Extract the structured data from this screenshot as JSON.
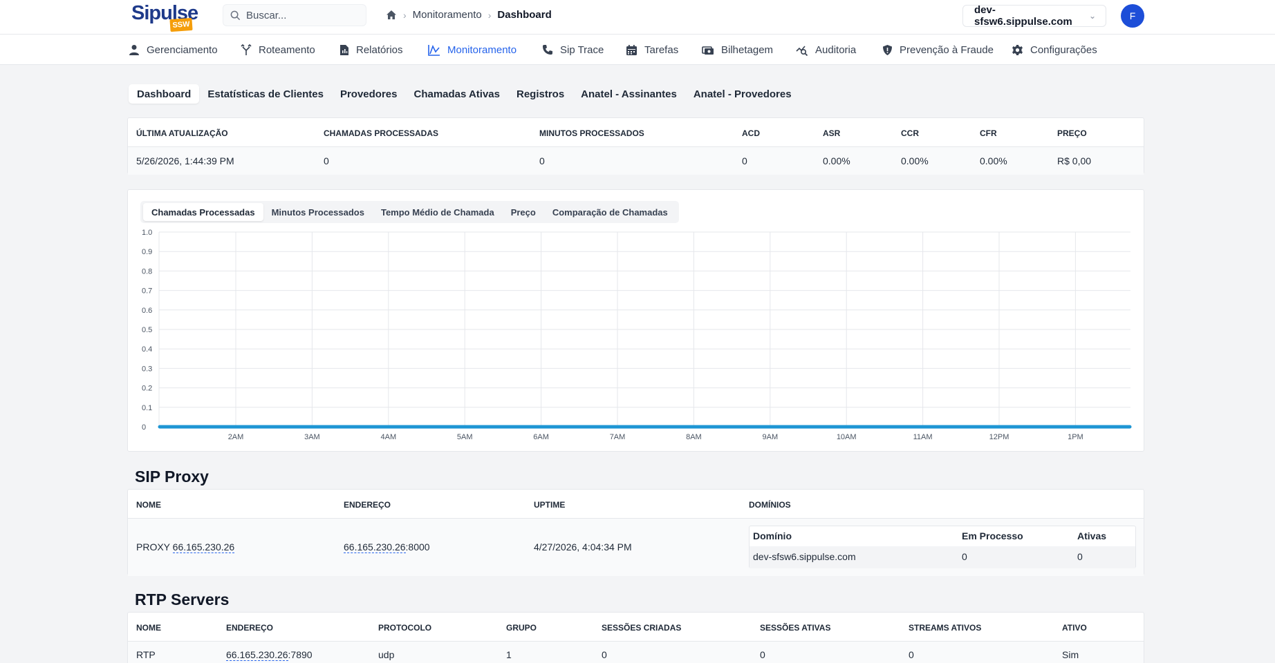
{
  "brand": {
    "logo_text": "Sipulse",
    "logo_badge": "SSW",
    "accent": "#2563eb",
    "orange": "#f59e0b"
  },
  "search": {
    "placeholder": "Buscar..."
  },
  "breadcrumb": {
    "parent": "Monitoramento",
    "current": "Dashboard"
  },
  "server": {
    "selected": "dev-sfsw6.sippulse.com"
  },
  "user": {
    "initial": "F"
  },
  "nav": [
    {
      "label": "Gerenciamento",
      "icon": "user-icon"
    },
    {
      "label": "Roteamento",
      "icon": "route-icon"
    },
    {
      "label": "Relatórios",
      "icon": "report-icon"
    },
    {
      "label": "Monitoramento",
      "icon": "chart-icon",
      "active": true
    },
    {
      "label": "Sip Trace",
      "icon": "phone-icon"
    },
    {
      "label": "Tarefas",
      "icon": "calendar-icon"
    },
    {
      "label": "Bilhetagem",
      "icon": "ticket-icon"
    },
    {
      "label": "Auditoria",
      "icon": "audit-icon"
    },
    {
      "label": "Prevenção à Fraude",
      "icon": "shield-icon"
    },
    {
      "label": "Configurações",
      "icon": "gear-icon"
    }
  ],
  "subtabs": [
    "Dashboard",
    "Estatísticas de Clientes",
    "Provedores",
    "Chamadas Ativas",
    "Registros",
    "Anatel - Assinantes",
    "Anatel - Provedores"
  ],
  "stats": {
    "headers": [
      "Última Atualização",
      "Chamadas Processadas",
      "Minutos Processados",
      "ACD",
      "ASR",
      "CCR",
      "CFR",
      "Preço"
    ],
    "values": [
      "5/26/2026, 1:44:39 PM",
      "0",
      "0",
      "0",
      "0.00%",
      "0.00%",
      "0.00%",
      "R$ 0,00"
    ]
  },
  "chart_tabs": [
    "Chamadas Processadas",
    "Minutos Processados",
    "Tempo Médio de Chamada",
    "Preço",
    "Comparação de Chamadas"
  ],
  "chart_data": {
    "type": "line",
    "title": "",
    "xlabel": "",
    "ylabel": "",
    "ylim": [
      0,
      1
    ],
    "yticks": [
      "1.0",
      "0.9",
      "0.8",
      "0.7",
      "0.6",
      "0.5",
      "0.4",
      "0.3",
      "0.2",
      "0.1",
      "0"
    ],
    "x": [
      "2AM",
      "3AM",
      "4AM",
      "5AM",
      "6AM",
      "7AM",
      "8AM",
      "9AM",
      "10AM",
      "11AM",
      "12PM",
      "1PM"
    ],
    "series": [
      {
        "values": [
          0,
          0,
          0,
          0,
          0,
          0,
          0,
          0,
          0,
          0,
          0,
          0,
          0,
          0
        ],
        "color": "#1e96d4"
      }
    ],
    "grid": true
  },
  "sip_proxy": {
    "title": "SIP Proxy",
    "headers": [
      "Nome",
      "Endereço",
      "Uptime",
      "Domínios"
    ],
    "name_prefix": "PROXY",
    "name_ip": "66.165.230.26",
    "address_ip": "66.165.230.26",
    "address_port": ":8000",
    "uptime": "4/27/2026, 4:04:34 PM",
    "domains": {
      "headers": [
        "Domínio",
        "Em Processo",
        "Ativas"
      ],
      "rows": [
        [
          "dev-sfsw6.sippulse.com",
          "0",
          "0"
        ]
      ]
    }
  },
  "rtp": {
    "title": "RTP Servers",
    "headers": [
      "Nome",
      "Endereço",
      "Protocolo",
      "Grupo",
      "Sessões Criadas",
      "Sessões Ativas",
      "Streams Ativos",
      "Ativo"
    ],
    "row": {
      "name": "RTP",
      "address_ip": "66.165.230.26",
      "address_port": ":7890",
      "protocol": "udp",
      "group": "1",
      "created": "0",
      "active_sessions": "0",
      "streams": "0",
      "active": "Sim"
    }
  }
}
